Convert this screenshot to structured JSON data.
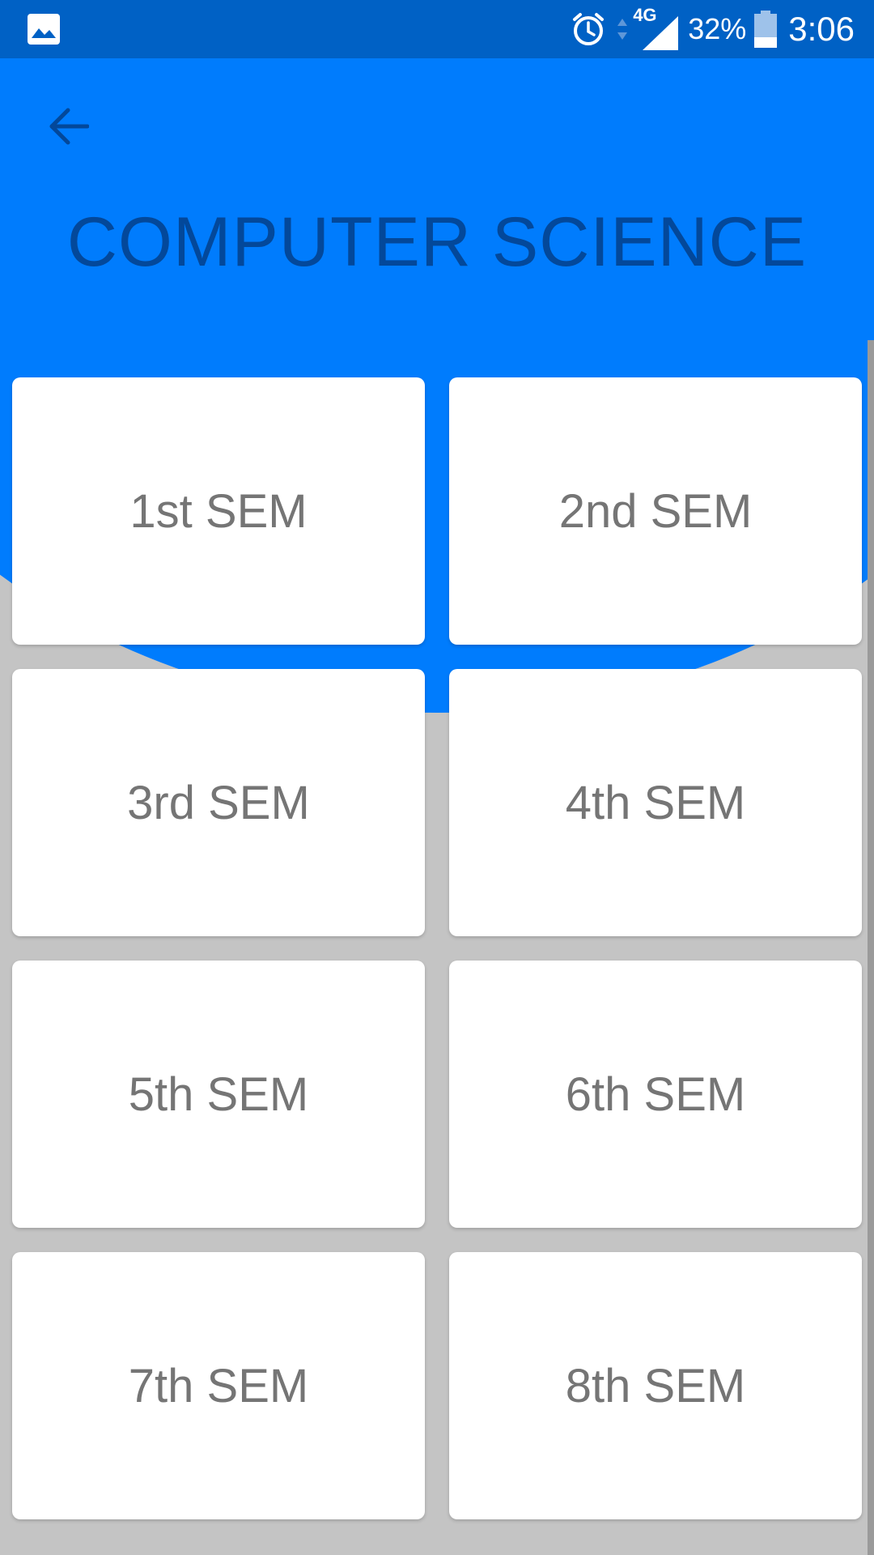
{
  "status_bar": {
    "left_icon": "image-icon",
    "alarm_icon": "alarm-clock-icon",
    "data_arrows_icon": "data-activity-icon",
    "network_label": "4G",
    "signal_icon": "signal-strength-icon",
    "battery_percent": "32%",
    "battery_icon": "battery-icon",
    "battery_level": 0.32,
    "time": "3:06"
  },
  "header": {
    "back_icon": "arrow-back-icon",
    "title": "COMPUTER SCIENCE"
  },
  "semesters": [
    {
      "label": "1st SEM"
    },
    {
      "label": "2nd SEM"
    },
    {
      "label": "3rd SEM"
    },
    {
      "label": "4th SEM"
    },
    {
      "label": "5th SEM"
    },
    {
      "label": "6th SEM"
    },
    {
      "label": "7th SEM"
    },
    {
      "label": "8th SEM"
    }
  ],
  "colors": {
    "status_bar": "#0061c5",
    "header": "#007cfd",
    "title_text": "#03489a",
    "background": "#c4c4c4",
    "card": "#ffffff",
    "card_text": "#757575"
  }
}
